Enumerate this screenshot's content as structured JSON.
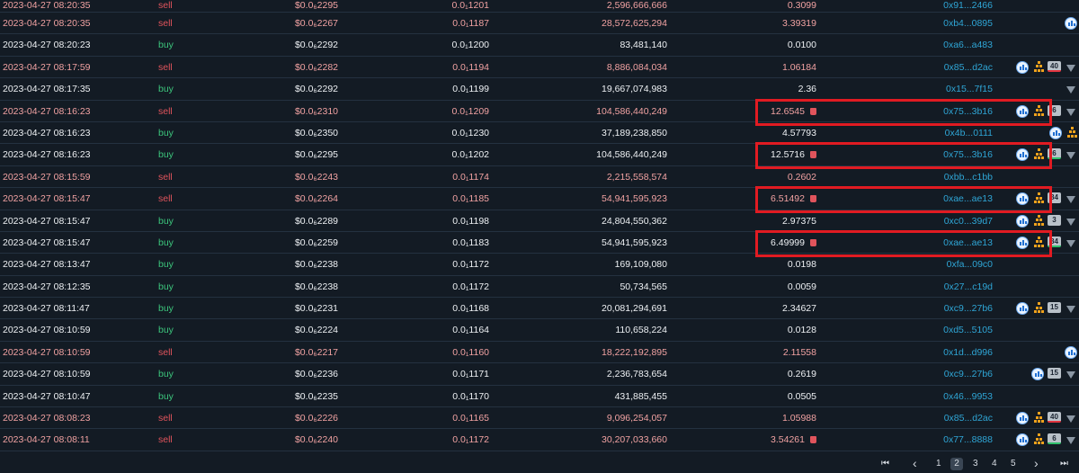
{
  "trades": [
    {
      "time": "2023-04-27 08:20:35",
      "type": "sell",
      "usd": "$0.0₆2267",
      "price": "0.0₁1187",
      "amount": "28,572,625,294",
      "total": "3.39319",
      "maker": "0xb4...0895",
      "icons": "chart",
      "badge": "",
      "badge_color": "",
      "funnel": false,
      "bag": false
    },
    {
      "time": "2023-04-27 08:20:23",
      "type": "buy",
      "usd": "$0.0₆2292",
      "price": "0.0₁1200",
      "amount": "83,481,140",
      "total": "0.0100",
      "maker": "0xa6...a483",
      "icons": "",
      "badge": "",
      "badge_color": "",
      "funnel": false,
      "bag": false
    },
    {
      "time": "2023-04-27 08:17:59",
      "type": "sell",
      "usd": "$0.0₆2282",
      "price": "0.0₁1194",
      "amount": "8,886,084,034",
      "total": "1.06184",
      "maker": "0x85...d2ac",
      "icons": "chart-pyr",
      "badge": "40",
      "badge_color": "red",
      "funnel": true,
      "bag": false
    },
    {
      "time": "2023-04-27 08:17:35",
      "type": "buy",
      "usd": "$0.0₆2292",
      "price": "0.0₁1199",
      "amount": "19,667,074,983",
      "total": "2.36",
      "maker": "0x15...7f15",
      "icons": "",
      "badge": "",
      "badge_color": "",
      "funnel": true,
      "bag": false
    },
    {
      "time": "2023-04-27 08:16:23",
      "type": "sell",
      "usd": "$0.0₆2310",
      "price": "0.0₁1209",
      "amount": "104,586,440,249",
      "total": "12.6545",
      "maker": "0x75...3b16",
      "icons": "chart-pyr",
      "badge": "6",
      "badge_color": "",
      "funnel": true,
      "bag": true
    },
    {
      "time": "2023-04-27 08:16:23",
      "type": "buy",
      "usd": "$0.0₆2350",
      "price": "0.0₁1230",
      "amount": "37,189,238,850",
      "total": "4.57793",
      "maker": "0x4b...0111",
      "icons": "chart-pyr",
      "badge": "",
      "badge_color": "",
      "funnel": false,
      "bag": false
    },
    {
      "time": "2023-04-27 08:16:23",
      "type": "buy",
      "usd": "$0.0₆2295",
      "price": "0.0₁1202",
      "amount": "104,586,440,249",
      "total": "12.5716",
      "maker": "0x75...3b16",
      "icons": "chart-pyr",
      "badge": "6",
      "badge_color": "green",
      "funnel": true,
      "bag": true
    },
    {
      "time": "2023-04-27 08:15:59",
      "type": "sell",
      "usd": "$0.0₆2243",
      "price": "0.0₁1174",
      "amount": "2,215,558,574",
      "total": "0.2602",
      "maker": "0xbb...c1bb",
      "icons": "",
      "badge": "",
      "badge_color": "",
      "funnel": false,
      "bag": false
    },
    {
      "time": "2023-04-27 08:15:47",
      "type": "sell",
      "usd": "$0.0₆2264",
      "price": "0.0₁1185",
      "amount": "54,941,595,923",
      "total": "6.51492",
      "maker": "0xae...ae13",
      "icons": "chart-pyr",
      "badge": "84",
      "badge_color": "",
      "funnel": true,
      "bag": true
    },
    {
      "time": "2023-04-27 08:15:47",
      "type": "buy",
      "usd": "$0.0₆2289",
      "price": "0.0₁1198",
      "amount": "24,804,550,362",
      "total": "2.97375",
      "maker": "0xc0...39d7",
      "icons": "chart-pyr",
      "badge": "3",
      "badge_color": "",
      "funnel": true,
      "bag": false
    },
    {
      "time": "2023-04-27 08:15:47",
      "type": "buy",
      "usd": "$0.0₆2259",
      "price": "0.0₁1183",
      "amount": "54,941,595,923",
      "total": "6.49999",
      "maker": "0xae...ae13",
      "icons": "chart-pyr",
      "badge": "84",
      "badge_color": "green",
      "funnel": true,
      "bag": true
    },
    {
      "time": "2023-04-27 08:13:47",
      "type": "buy",
      "usd": "$0.0₆2238",
      "price": "0.0₁1172",
      "amount": "169,109,080",
      "total": "0.0198",
      "maker": "0xfa...09c0",
      "icons": "",
      "badge": "",
      "badge_color": "",
      "funnel": false,
      "bag": false
    },
    {
      "time": "2023-04-27 08:12:35",
      "type": "buy",
      "usd": "$0.0₆2238",
      "price": "0.0₁1172",
      "amount": "50,734,565",
      "total": "0.0059",
      "maker": "0x27...c19d",
      "icons": "",
      "badge": "",
      "badge_color": "",
      "funnel": false,
      "bag": false
    },
    {
      "time": "2023-04-27 08:11:47",
      "type": "buy",
      "usd": "$0.0₆2231",
      "price": "0.0₁1168",
      "amount": "20,081,294,691",
      "total": "2.34627",
      "maker": "0xc9...27b6",
      "icons": "chart-pyr",
      "badge": "15",
      "badge_color": "",
      "funnel": true,
      "bag": false
    },
    {
      "time": "2023-04-27 08:10:59",
      "type": "buy",
      "usd": "$0.0₆2224",
      "price": "0.0₁1164",
      "amount": "110,658,224",
      "total": "0.0128",
      "maker": "0xd5...5105",
      "icons": "",
      "badge": "",
      "badge_color": "",
      "funnel": false,
      "bag": false
    },
    {
      "time": "2023-04-27 08:10:59",
      "type": "sell",
      "usd": "$0.0₆2217",
      "price": "0.0₁1160",
      "amount": "18,222,192,895",
      "total": "2.11558",
      "maker": "0x1d...d996",
      "icons": "chart",
      "badge": "",
      "badge_color": "",
      "funnel": false,
      "bag": false
    },
    {
      "time": "2023-04-27 08:10:59",
      "type": "buy",
      "usd": "$0.0₆2236",
      "price": "0.0₁1171",
      "amount": "2,236,783,654",
      "total": "0.2619",
      "maker": "0xc9...27b6",
      "icons": "chart",
      "badge": "15",
      "badge_color": "",
      "funnel": true,
      "bag": false
    },
    {
      "time": "2023-04-27 08:10:47",
      "type": "buy",
      "usd": "$0.0₆2235",
      "price": "0.0₁1170",
      "amount": "431,885,455",
      "total": "0.0505",
      "maker": "0x46...9953",
      "icons": "",
      "badge": "",
      "badge_color": "",
      "funnel": false,
      "bag": false
    },
    {
      "time": "2023-04-27 08:08:23",
      "type": "sell",
      "usd": "$0.0₆2226",
      "price": "0.0₁1165",
      "amount": "9,096,254,057",
      "total": "1.05988",
      "maker": "0x85...d2ac",
      "icons": "chart-pyr",
      "badge": "40",
      "badge_color": "red",
      "funnel": true,
      "bag": false
    },
    {
      "time": "2023-04-27 08:08:11",
      "type": "sell",
      "usd": "$0.0₆2240",
      "price": "0.0₁1172",
      "amount": "30,207,033,660",
      "total": "3.54261",
      "maker": "0x77...8888",
      "icons": "chart-pyr",
      "badge": "6",
      "badge_color": "green",
      "funnel": true,
      "bag": true
    }
  ],
  "top_partial": {
    "time": "2023-04-27 08:20:35",
    "type": "sell",
    "usd": "$0.0₆2295",
    "price": "0.0₁1201",
    "amount": "2,596,666,666",
    "total": "0.3099",
    "maker": "0x91...2466"
  },
  "highlighted_rows": [
    4,
    6,
    8,
    10
  ],
  "pagination": {
    "first": "⏮",
    "prev": "‹",
    "pages": [
      "1",
      "2",
      "3",
      "4",
      "5"
    ],
    "current": "2",
    "next": "›",
    "last": "⏭"
  },
  "colors": {
    "background": "#131b24",
    "sell": "#e0545c",
    "buy": "#3cc57c",
    "maker": "#2fa6d6",
    "highlight": "#e11b22"
  }
}
